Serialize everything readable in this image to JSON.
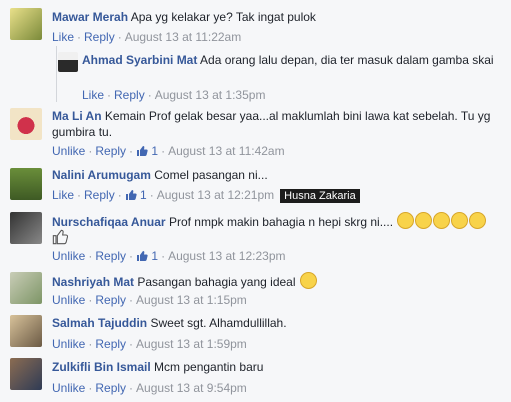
{
  "comments": [
    {
      "author": "Mawar Merah",
      "text": "Apa yg kelakar ye? Tak ingat pulok",
      "actions": [
        "Like",
        "Reply"
      ],
      "date": "August 13 at 11:22am"
    },
    {
      "author": "Ahmad Syarbini Mat",
      "text": "Ada orang lalu depan, dia ter masuk dalam gamba skai",
      "actions": [
        "Like",
        "Reply"
      ],
      "date": "August 13 at 1:35pm"
    },
    {
      "author": "Ma Li An",
      "text": "Kemain Prof gelak besar yaa...al maklumlah bini lawa kat sebelah. Tu yg gumbira tu.",
      "actions": [
        "Unlike",
        "Reply"
      ],
      "likes": "1",
      "date": "August 13 at 11:42am"
    },
    {
      "author": "Nalini Arumugam",
      "text": "Comel pasangan ni...",
      "actions": [
        "Like",
        "Reply"
      ],
      "likes": "1",
      "date": "August 13 at 12:21pm",
      "tag": "Husna Zakaria"
    },
    {
      "author": "Nurschafiqaa Anuar",
      "text": "Prof nmpk makin bahagia n hepi skrg ni....",
      "actions": [
        "Unlike",
        "Reply"
      ],
      "likes": "1",
      "date": "August 13 at 12:23pm"
    },
    {
      "author": "Nashriyah Mat",
      "text": "Pasangan bahagia yang ideal",
      "actions": [
        "Unlike",
        "Reply"
      ],
      "date": "August 13 at 1:15pm"
    },
    {
      "author": "Salmah Tajuddin",
      "text": "Sweet sgt. Alhamdullillah.",
      "actions": [
        "Unlike",
        "Reply"
      ],
      "date": "August 13 at 1:59pm"
    },
    {
      "author": "Zulkifli Bin Ismail",
      "text": "Mcm pengantin baru",
      "actions": [
        "Unlike",
        "Reply"
      ],
      "date": "August 13 at 9:54pm"
    }
  ]
}
